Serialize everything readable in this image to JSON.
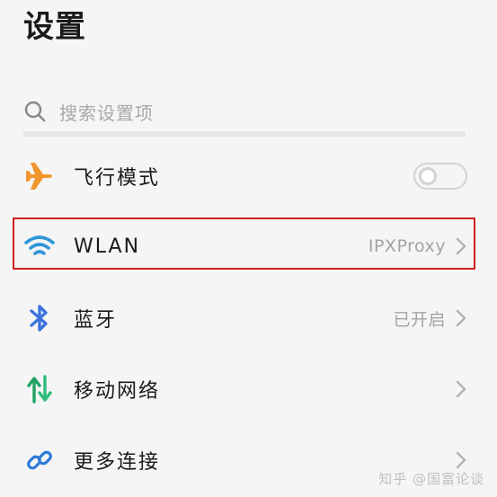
{
  "header": {
    "title": "设置"
  },
  "search": {
    "placeholder": "搜索设置项"
  },
  "rows": [
    {
      "label": "飞行模式",
      "icon": "airplane-icon",
      "toggle_on": false
    },
    {
      "label": "WLAN",
      "icon": "wifi-icon",
      "value": "IPXProxy"
    },
    {
      "label": "蓝牙",
      "icon": "bluetooth-icon",
      "value": "已开启"
    },
    {
      "label": "移动网络",
      "icon": "mobile-data-icon"
    },
    {
      "label": "更多连接",
      "icon": "link-icon"
    }
  ],
  "colors": {
    "airplane": "#f0962e",
    "wifi": "#2e95d8",
    "bluetooth": "#3d73dc",
    "mobile_up": "#1fa366",
    "mobile_down": "#2dbb7a",
    "link": "#2f7ad8",
    "highlight": "#d0201e"
  },
  "watermark": "知乎 @国富论谈"
}
